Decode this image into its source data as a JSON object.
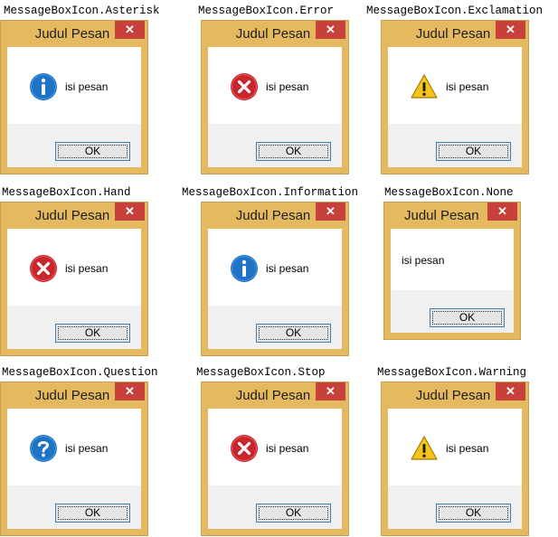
{
  "dialogs": [
    {
      "caption": "MessageBoxIcon.Asterisk",
      "title": "Judul Pesan",
      "close": "✕",
      "icon": "information-icon",
      "message": "isi pesan",
      "ok": "OK"
    },
    {
      "caption": "MessageBoxIcon.Error",
      "title": "Judul Pesan",
      "close": "✕",
      "icon": "error-icon",
      "message": "isi pesan",
      "ok": "OK"
    },
    {
      "caption": "MessageBoxIcon.Exclamation",
      "title": "Judul Pesan",
      "close": "✕",
      "icon": "warning-icon",
      "message": "isi pesan",
      "ok": "OK"
    },
    {
      "caption": "MessageBoxIcon.Hand",
      "title": "Judul Pesan",
      "close": "✕",
      "icon": "error-icon",
      "message": "isi pesan",
      "ok": "OK"
    },
    {
      "caption": "MessageBoxIcon.Information",
      "title": "Judul Pesan",
      "close": "✕",
      "icon": "information-icon",
      "message": "isi pesan",
      "ok": "OK"
    },
    {
      "caption": "MessageBoxIcon.None",
      "title": "Judul Pesan",
      "close": "✕",
      "icon": "",
      "message": "isi pesan",
      "ok": "OK"
    },
    {
      "caption": "MessageBoxIcon.Question",
      "title": "Judul Pesan",
      "close": "✕",
      "icon": "question-icon",
      "message": "isi pesan",
      "ok": "OK"
    },
    {
      "caption": "MessageBoxIcon.Stop",
      "title": "Judul Pesan",
      "close": "✕",
      "icon": "error-icon",
      "message": "isi pesan",
      "ok": "OK"
    },
    {
      "caption": "MessageBoxIcon.Warning",
      "title": "Judul Pesan",
      "close": "✕",
      "icon": "warning-icon",
      "message": "isi pesan",
      "ok": "OK"
    }
  ],
  "colors": {
    "window_frame": "#e4b960",
    "close_button": "#c7403a",
    "info_icon": "#1e73c6",
    "error_icon": "#c9252c",
    "warning_icon": "#f5c518",
    "ok_border": "#3c7fb1"
  }
}
